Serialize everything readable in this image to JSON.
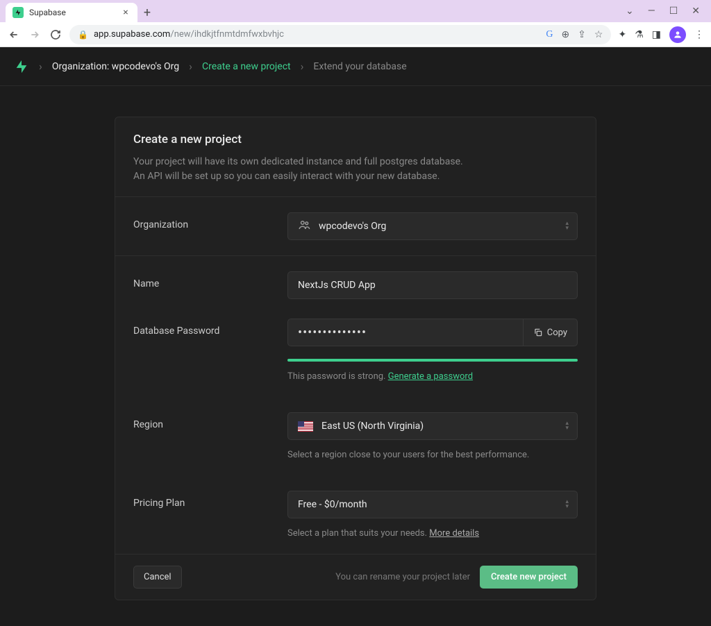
{
  "browser": {
    "tab_title": "Supabase",
    "url_domain": "app.supabase.com",
    "url_path": "/new/ihdkjtfnmtdmfwxbvhjc"
  },
  "breadcrumb": {
    "org": "Organization: wpcodevo's Org",
    "step1": "Create a new project",
    "step2": "Extend your database"
  },
  "header": {
    "title": "Create a new project",
    "desc_line1": "Your project will have its own dedicated instance and full postgres database.",
    "desc_line2": "An API will be set up so you can easily interact with your new database."
  },
  "fields": {
    "org": {
      "label": "Organization",
      "value": "wpcodevo's Org"
    },
    "name": {
      "label": "Name",
      "value": "NextJs CRUD App"
    },
    "password": {
      "label": "Database Password",
      "masked": "••••••••••••••",
      "copy": "Copy",
      "hint_prefix": "This password is strong. ",
      "generate_link": "Generate a password"
    },
    "region": {
      "label": "Region",
      "value": "East US (North Virginia)",
      "hint": "Select a region close to your users for the best performance."
    },
    "plan": {
      "label": "Pricing Plan",
      "value": "Free - $0/month",
      "hint_prefix": "Select a plan that suits your needs. ",
      "details_link": "More details"
    }
  },
  "footer": {
    "cancel": "Cancel",
    "hint": "You can rename your project later",
    "submit": "Create new project"
  }
}
